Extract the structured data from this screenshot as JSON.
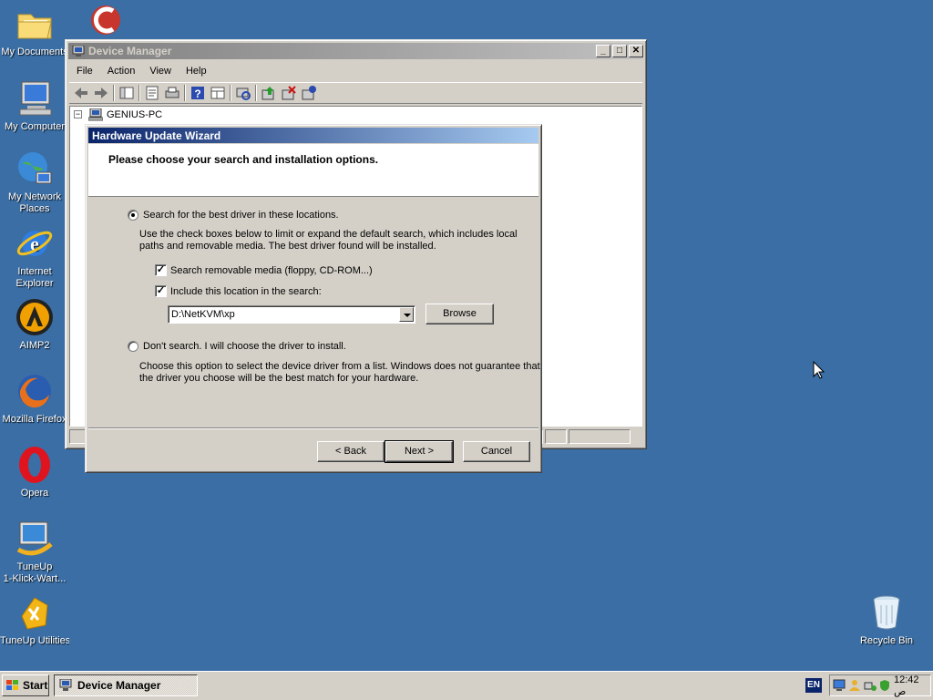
{
  "desktop": {
    "icons": [
      {
        "label": "My Documents"
      },
      {
        "label": "My Computer"
      },
      {
        "label_line1": "My Network",
        "label_line2": "Places"
      },
      {
        "label_line1": "Internet",
        "label_line2": "Explorer"
      },
      {
        "label": "AIMP2"
      },
      {
        "label": "Mozilla Firefox"
      },
      {
        "label": "Opera"
      },
      {
        "label_line1": "TuneUp",
        "label_line2": "1-Klick-Wart..."
      },
      {
        "label": "TuneUp Utilities"
      },
      {
        "label": "Recycle Bin"
      }
    ]
  },
  "device_manager": {
    "title": "Device Manager",
    "menu": [
      "File",
      "Action",
      "View",
      "Help"
    ],
    "tree_root": "GENIUS-PC"
  },
  "wizard": {
    "title": "Hardware Update Wizard",
    "heading": "Please choose your search and installation options.",
    "option_search": {
      "label": "Search for the best driver in these locations.",
      "selected": true,
      "desc_line1": "Use the check boxes below to limit or expand the default search, which includes local",
      "desc_line2": "paths and removable media. The best driver found will be installed."
    },
    "check_removable": {
      "label": "Search removable media (floppy, CD-ROM...)",
      "checked": true
    },
    "check_location": {
      "label": "Include this location in the search:",
      "checked": true
    },
    "location_value": "D:\\NetKVM\\xp",
    "browse_label": "Browse",
    "option_dont_search": {
      "label": "Don't search. I will choose the driver to install.",
      "selected": false,
      "desc_line1": "Choose this option to select the device driver from a list.  Windows does not guarantee that",
      "desc_line2": "the driver you choose will be the best match for your hardware."
    },
    "back_label": "< Back",
    "next_label": "Next >",
    "cancel_label": "Cancel"
  },
  "taskbar": {
    "start_label": "Start",
    "task_label": "Device Manager",
    "lang": "EN",
    "clock": "12:42 ص"
  }
}
